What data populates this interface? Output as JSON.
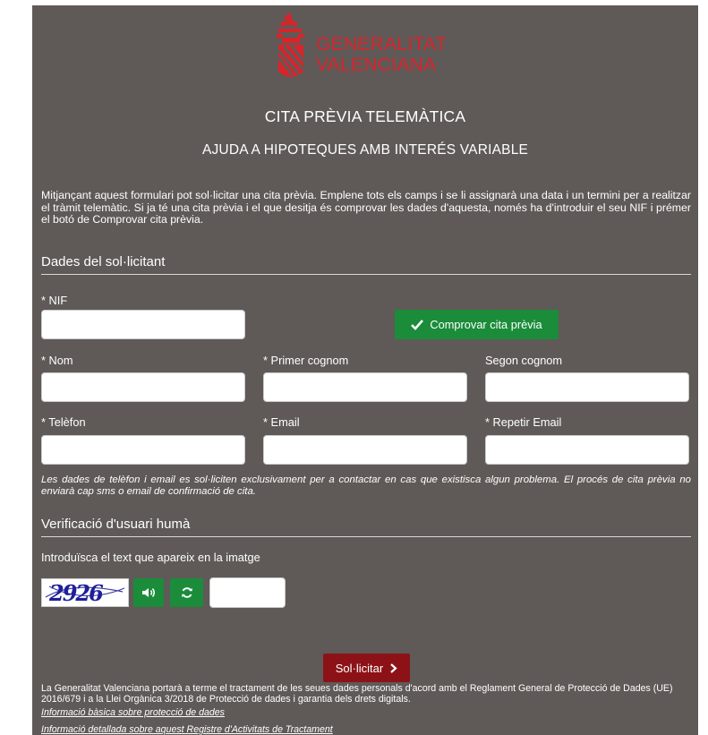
{
  "brand": {
    "line1": "GENERALITAT",
    "line2": "VALENCIANA",
    "color": "#d6242a",
    "icon": "generalitat-crest-icon"
  },
  "page": {
    "title": "CITA PRÈVIA TELEMÀTICA",
    "subtitle": "AJUDA A HIPOTEQUES AMB INTERÉS VARIABLE",
    "intro": "Mitjançant aquest formulari pot sol·licitar una cita prèvia. Emplene tots els camps i se li assignarà una data i un termini per a realitzar el tràmit telemàtic. Si ja té una cita prèvia i el que desitja és comprovar les dades d'aquesta, només ha d'introduir el seu NIF i prémer el botó de Comprovar cita prèvia."
  },
  "applicant_section": {
    "heading": "Dades del sol·licitant",
    "nif_label": "* NIF",
    "nif_value": "",
    "check_button": "Comprovar cita prèvia",
    "nom_label": "* Nom",
    "primer_cognom_label": "* Primer cognom",
    "segon_cognom_label": "Segon cognom",
    "telefon_label": "* Telèfon",
    "email_label": "* Email",
    "repetir_email_label": "* Repetir Email",
    "note": "Les dades de telèfon i email es sol·liciten exclusivament per a contactar en cas que existisca algun problema. El procés de cita prèvia no enviarà cap sms o email de confirmació de cita."
  },
  "captcha_section": {
    "heading": "Verificació d'usuari humà",
    "instruction": "Introduïsca el text que apareix en la imatge",
    "captcha_text": "2926",
    "audio_icon": "speaker-icon",
    "refresh_icon": "refresh-icon",
    "input_value": ""
  },
  "submit": {
    "label": "Sol·licitar",
    "icon": "chevron-right-icon"
  },
  "legal": {
    "text": "La Generalitat Valenciana portarà a terme el tractament de les seues dades personals d'acord amb el Reglament General de Protecció de Dades (UE) 2016/679 i a la Llei Orgànica 3/2018 de Protecció de dades i garantia dels drets digitals.",
    "link1": "Informació bàsica sobre protecció de dades",
    "link2": "Informació detallada sobre aquest Registre d'Activitats de Tractament"
  },
  "colors": {
    "panel": "#5f5a58",
    "green": "#1a8c3a",
    "red": "#8c1217"
  }
}
